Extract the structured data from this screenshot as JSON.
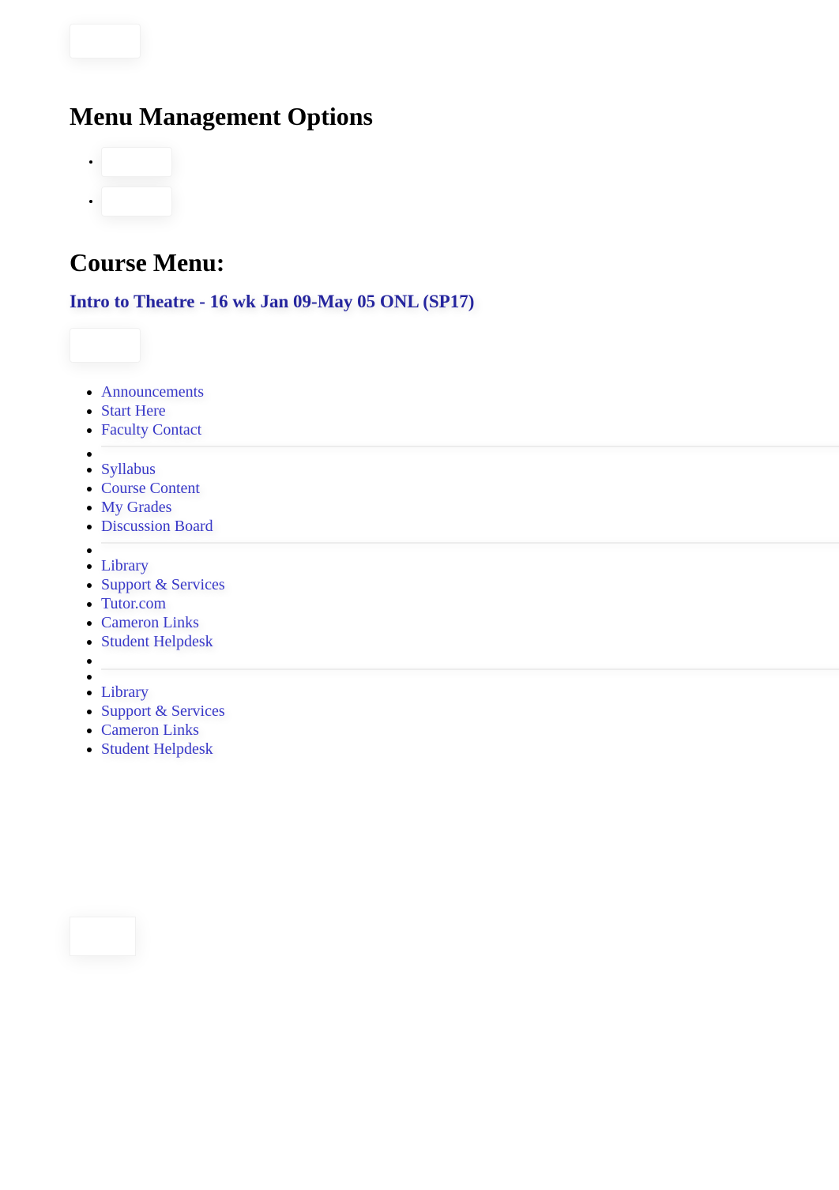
{
  "headings": {
    "menu_management": "Menu Management Options",
    "course_menu": "Course Menu:"
  },
  "course": {
    "title": "Intro to Theatre - 16 wk Jan 09-May 05 ONL (SP17)"
  },
  "nav": {
    "group1": [
      {
        "label": "Announcements",
        "name": "nav-announcements"
      },
      {
        "label": "Start Here",
        "name": "nav-start-here"
      },
      {
        "label": "Faculty Contact",
        "name": "nav-faculty-contact"
      }
    ],
    "group2": [
      {
        "label": "Syllabus",
        "name": "nav-syllabus"
      },
      {
        "label": "Course Content",
        "name": "nav-course-content"
      },
      {
        "label": "My Grades",
        "name": "nav-my-grades"
      },
      {
        "label": "Discussion Board",
        "name": "nav-discussion-board"
      }
    ],
    "group3": [
      {
        "label": "Library",
        "name": "nav-library"
      },
      {
        "label": "Support & Services",
        "name": "nav-support-services"
      },
      {
        "label": "Tutor.com",
        "name": "nav-tutor-com"
      },
      {
        "label": "Cameron Links",
        "name": "nav-cameron-links"
      },
      {
        "label": "Student Helpdesk",
        "name": "nav-student-helpdesk"
      }
    ],
    "group4": [
      {
        "label": "Library",
        "name": "nav-library-2"
      },
      {
        "label": "Support & Services",
        "name": "nav-support-services-2"
      },
      {
        "label": "Cameron Links",
        "name": "nav-cameron-links-2"
      },
      {
        "label": "Student Helpdesk",
        "name": "nav-student-helpdesk-2"
      }
    ]
  }
}
